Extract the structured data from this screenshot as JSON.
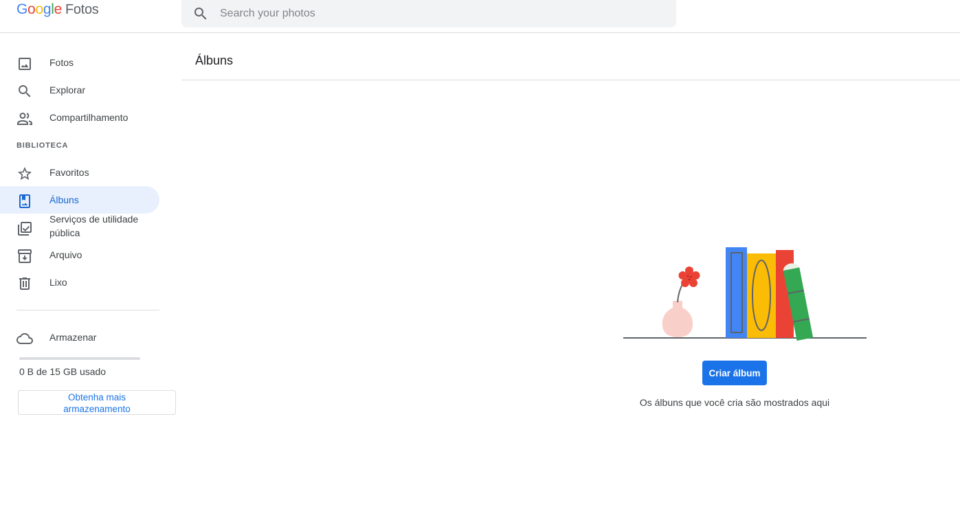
{
  "header": {
    "brand": {
      "letters": [
        "G",
        "o",
        "o",
        "g",
        "l",
        "e"
      ],
      "product": "Fotos"
    },
    "search": {
      "placeholder": "Search your photos",
      "icon": "search-icon"
    }
  },
  "sidebar": {
    "items": [
      {
        "label": "Fotos",
        "icon": "photo-icon"
      },
      {
        "label": "Explorar",
        "icon": "search-icon"
      },
      {
        "label": "Compartilhamento",
        "icon": "people-icon"
      }
    ],
    "library_title": "BIBLIOTECA",
    "library_items": [
      {
        "label": "Favoritos",
        "icon": "star-icon"
      },
      {
        "label": "Álbuns",
        "icon": "album-icon",
        "active": true
      },
      {
        "label_line1": "Serviços de utilidade",
        "label_line2": "pública",
        "icon": "utilities-icon"
      },
      {
        "label": "Arquivo",
        "icon": "archive-icon"
      },
      {
        "label": "Lixo",
        "icon": "trash-icon"
      }
    ],
    "storage": {
      "label": "Armazenar",
      "icon": "cloud-icon",
      "usage_text": "0 B de 15 GB usado",
      "usage_fraction": 0,
      "button_line1": "Obtenha mais",
      "button_line2": "armazenamento"
    }
  },
  "main": {
    "title": "Álbuns",
    "create_button": "Criar álbum",
    "empty_message": "Os álbuns que você cria são mostrados aqui"
  },
  "colors": {
    "accent": "#1a73e8",
    "active_bg": "#e8f0fe",
    "active_text": "#1967d2"
  }
}
